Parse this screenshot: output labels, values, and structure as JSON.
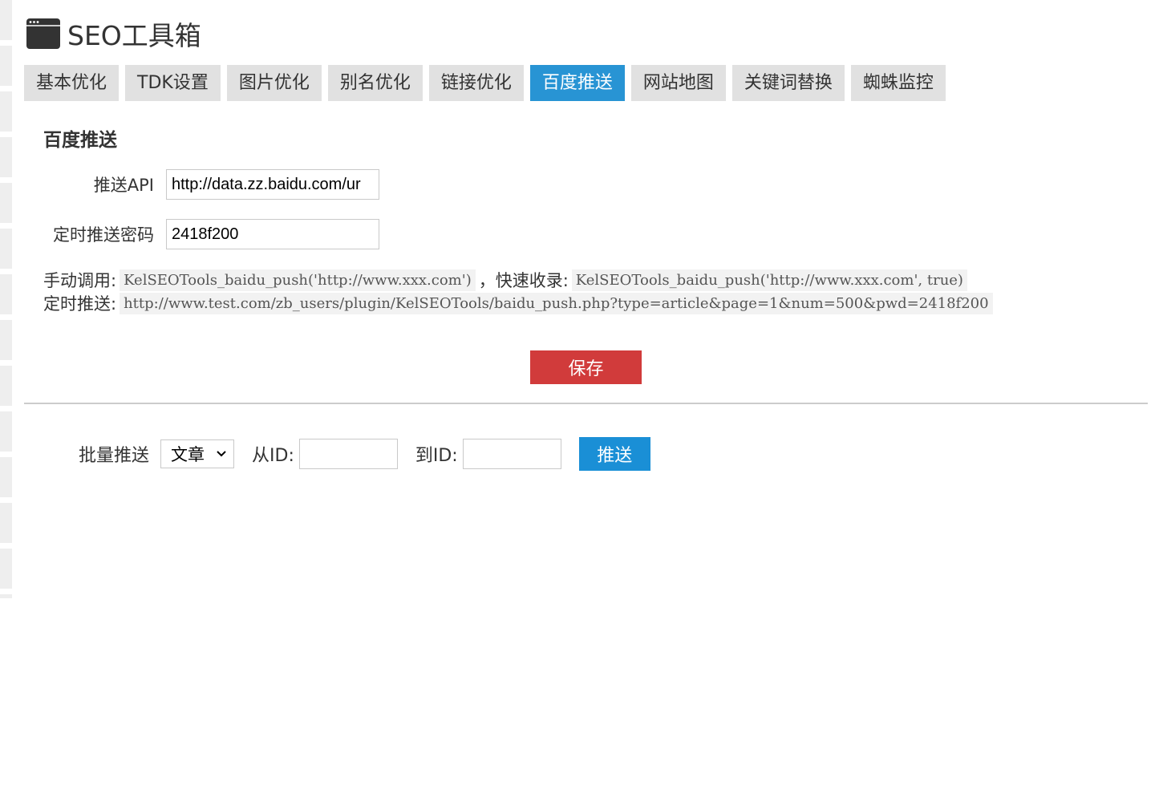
{
  "header": {
    "title": "SEO工具箱",
    "logo_icon": "browser-window-icon"
  },
  "tabs": [
    {
      "label": "基本优化",
      "active": false
    },
    {
      "label": "TDK设置",
      "active": false
    },
    {
      "label": "图片优化",
      "active": false
    },
    {
      "label": "别名优化",
      "active": false
    },
    {
      "label": "链接优化",
      "active": false
    },
    {
      "label": "百度推送",
      "active": true
    },
    {
      "label": "网站地图",
      "active": false
    },
    {
      "label": "关键词替换",
      "active": false
    },
    {
      "label": "蜘蛛监控",
      "active": false
    }
  ],
  "section": {
    "title": "百度推送"
  },
  "form": {
    "api_label": "推送API",
    "api_value": "http://data.zz.baidu.com/ur",
    "password_label": "定时推送密码",
    "password_value": "2418f200"
  },
  "help": {
    "manual_label": "手动调用:",
    "manual_code": "KelSEOTools_baidu_push('http://www.xxx.com')",
    "separator": "，",
    "quick_label": "快速收录:",
    "quick_code": "KelSEOTools_baidu_push('http://www.xxx.com', true)",
    "timed_label": "定时推送:",
    "timed_code": "http://www.test.com/zb_users/plugin/KelSEOTools/baidu_push.php?type=article&page=1&num=500&pwd=2418f200"
  },
  "save_button": {
    "label": "保存"
  },
  "batch": {
    "label": "批量推送",
    "type_selected": "文章",
    "from_label": "从ID:",
    "from_value": "",
    "to_label": "到ID:",
    "to_value": "",
    "push_label": "推送"
  },
  "colors": {
    "active_tab": "#2894d4",
    "save_button": "#d13b3b",
    "push_button": "#1a8fd6"
  }
}
